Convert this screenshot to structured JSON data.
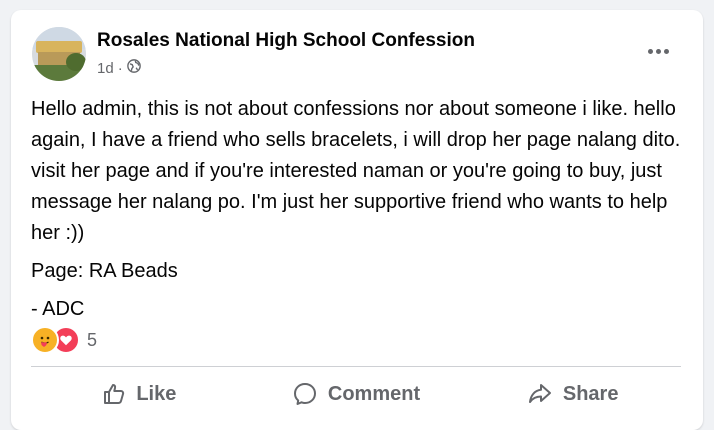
{
  "post": {
    "page_name": "Rosales National High School Confession",
    "time": "1d",
    "separator": "·",
    "privacy_icon": "globe-icon",
    "paragraphs": [
      "Hello admin, this is not about confessions nor about someone i like. hello again, I have a friend who sells bracelets, i will drop her page nalang dito. visit her page and if you're interested naman or you're going to buy, just message her nalang po. I'm just her supportive friend who wants to help her :))",
      "Page: RA Beads",
      "- ADC"
    ],
    "reactions": {
      "icons": [
        "care-reaction-icon",
        "love-reaction-icon"
      ],
      "count": "5"
    }
  },
  "actions": {
    "like": "Like",
    "comment": "Comment",
    "share": "Share"
  },
  "colors": {
    "background": "#f0f2f5",
    "card": "#ffffff",
    "secondary_text": "#65676b",
    "care": "#f7b125",
    "love": "#f33e58"
  }
}
